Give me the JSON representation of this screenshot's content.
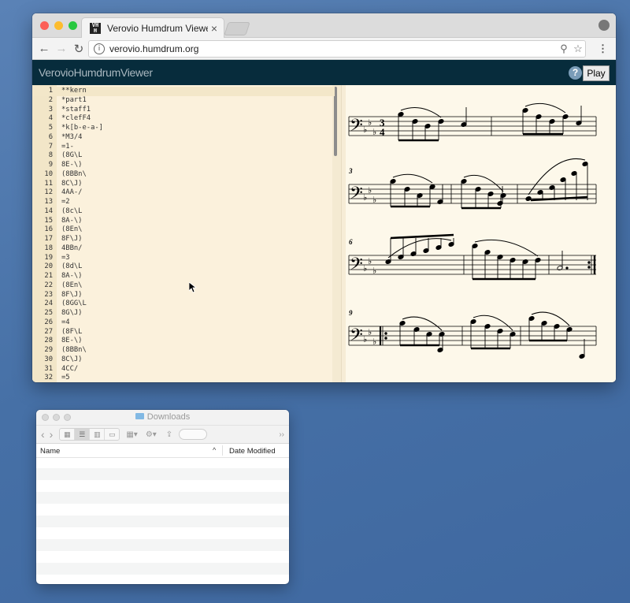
{
  "browser": {
    "tab_title": "Verovio Humdrum Viewer",
    "tab_favicon_text": "VH\nH",
    "tab_close": "×",
    "url": "verovio.humdrum.org",
    "nav": {
      "back": "←",
      "forward": "→",
      "reload": "↻"
    },
    "icons": {
      "info": "i",
      "zoom": "⚲",
      "star": "☆",
      "menu": "⋮"
    }
  },
  "app": {
    "title": "VerovioHumdrumViewer",
    "help_label": "?",
    "play_label": "Play"
  },
  "editor": {
    "active_line": 1,
    "lines": [
      {
        "n": "1",
        "code": "**kern"
      },
      {
        "n": "2",
        "code": "*part1"
      },
      {
        "n": "3",
        "code": "*staff1"
      },
      {
        "n": "4",
        "code": "*clefF4"
      },
      {
        "n": "5",
        "code": "*k[b-e-a-]"
      },
      {
        "n": "6",
        "code": "*M3/4"
      },
      {
        "n": "7",
        "code": "=1-"
      },
      {
        "n": "8",
        "code": "(8G\\L"
      },
      {
        "n": "9",
        "code": "8E-\\)"
      },
      {
        "n": "10",
        "code": "(8BBn\\"
      },
      {
        "n": "11",
        "code": "8C\\J)"
      },
      {
        "n": "12",
        "code": "4AA-/"
      },
      {
        "n": "13",
        "code": "=2"
      },
      {
        "n": "14",
        "code": "(8c\\L"
      },
      {
        "n": "15",
        "code": "8A-\\)"
      },
      {
        "n": "16",
        "code": "(8En\\"
      },
      {
        "n": "17",
        "code": "8F\\J)"
      },
      {
        "n": "18",
        "code": "4BBn/"
      },
      {
        "n": "19",
        "code": "=3"
      },
      {
        "n": "20",
        "code": "(8d\\L"
      },
      {
        "n": "21",
        "code": "8A-\\)"
      },
      {
        "n": "22",
        "code": "(8En\\"
      },
      {
        "n": "23",
        "code": "8F\\J)"
      },
      {
        "n": "24",
        "code": "(8GG\\L"
      },
      {
        "n": "25",
        "code": "8G\\J)"
      },
      {
        "n": "26",
        "code": "=4"
      },
      {
        "n": "27",
        "code": "(8F\\L"
      },
      {
        "n": "28",
        "code": "8E-\\)"
      },
      {
        "n": "29",
        "code": "(8BBn\\"
      },
      {
        "n": "30",
        "code": "8C\\J)"
      },
      {
        "n": "31",
        "code": "4CC/"
      },
      {
        "n": "32",
        "code": "=5"
      }
    ]
  },
  "notation": {
    "time_signature_top": "3",
    "time_signature_bottom": "4",
    "measure_numbers": [
      "3",
      "6",
      "9"
    ]
  },
  "finder": {
    "title": "Downloads",
    "columns": {
      "name": "Name",
      "date": "Date Modified"
    },
    "sort_arrow": "^",
    "toolbar": {
      "back": "‹",
      "forward": "›",
      "more": "››"
    }
  },
  "colors": {
    "desktop": "#4a73a8",
    "app_header": "#072c3c",
    "editor_bg": "#fbf1dc",
    "notation_bg": "#fdf8ea"
  }
}
